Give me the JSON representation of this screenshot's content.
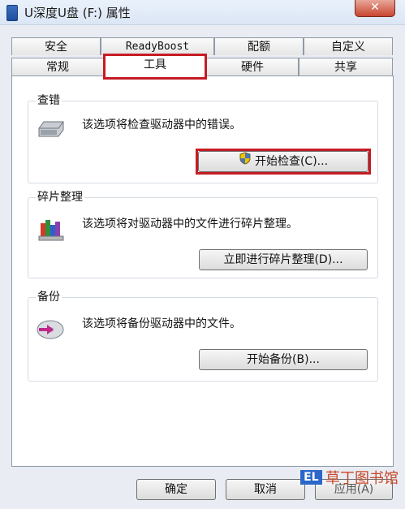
{
  "window": {
    "title": "U深度U盘 (F:) 属性",
    "close_glyph": "✕"
  },
  "tabs_top": [
    "安全",
    "ReadyBoost",
    "配额",
    "自定义"
  ],
  "tabs_bottom": [
    "常规",
    "工具",
    "硬件",
    "共享"
  ],
  "active_tab": "工具",
  "groups": {
    "check": {
      "label": "查错",
      "desc": "该选项将检查驱动器中的错误。",
      "button": "开始检查(C)..."
    },
    "defrag": {
      "label": "碎片整理",
      "desc": "该选项将对驱动器中的文件进行碎片整理。",
      "button": "立即进行碎片整理(D)..."
    },
    "backup": {
      "label": "备份",
      "desc": "该选项将备份驱动器中的文件。",
      "button": "开始备份(B)..."
    }
  },
  "footer": {
    "ok": "确定",
    "cancel": "取消",
    "apply": "应用(A)"
  },
  "watermark": {
    "text": "草丁图书馆",
    "logo": "EL"
  },
  "icons": [
    "drive-icon",
    "shield-icon",
    "defrag-icon",
    "backup-icon"
  ],
  "colors": {
    "highlight": "#c61b24",
    "title_bg": "#dbe6f5",
    "close": "#c8452f"
  }
}
